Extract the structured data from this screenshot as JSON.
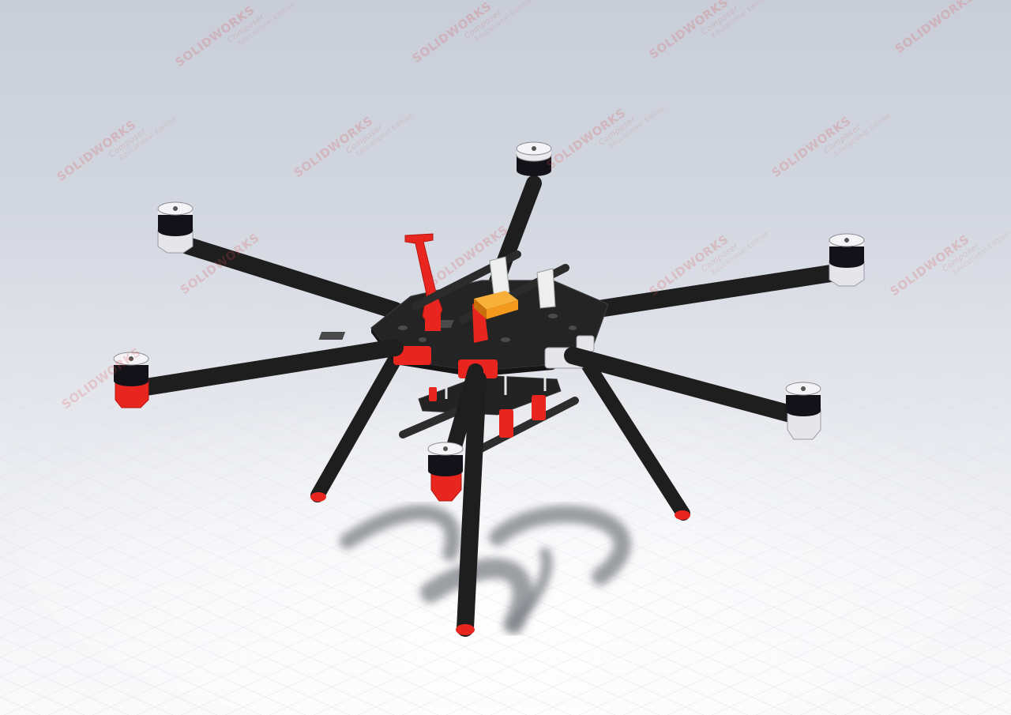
{
  "viewport": {
    "background_top": "#c9cdd8",
    "background_bottom": "#fafafb"
  },
  "watermark": {
    "brand": "SOLIDWORKS",
    "product": "Composer",
    "edition": "Educational Edition"
  },
  "model": {
    "frame_color": "#1e1e1e",
    "accent_red": "#e8261f",
    "motor_top": "#e9e9ec",
    "motor_band": "#121218",
    "battery_color": "#f39a1c"
  }
}
